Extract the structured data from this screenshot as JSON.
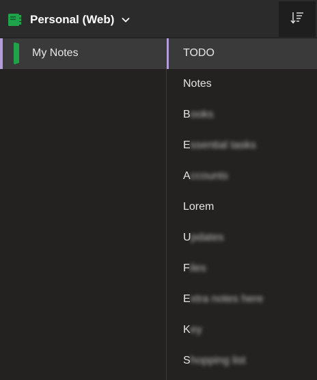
{
  "header": {
    "notebook_title": "Personal (Web)",
    "notebook_icon": "notebook-icon",
    "dropdown_icon": "chevron-down-icon",
    "sort_icon": "sort-icon",
    "accent_color": "#1fa34a"
  },
  "sections": {
    "items": [
      {
        "label": "My Notes",
        "selected": true,
        "color": "#1fa34a"
      }
    ],
    "selection_color": "#b39ddb"
  },
  "pages": {
    "items": [
      {
        "first": "TODO",
        "rest": "",
        "selected": true
      },
      {
        "first": "Notes",
        "rest": ""
      },
      {
        "first": "B",
        "rest": "ooks"
      },
      {
        "first": "E",
        "rest": "ssential tasks"
      },
      {
        "first": "A",
        "rest": "ccounts"
      },
      {
        "first": "Lorem",
        "rest": ""
      },
      {
        "first": "U",
        "rest": "pdates"
      },
      {
        "first": "F",
        "rest": "iles"
      },
      {
        "first": "E",
        "rest": "xtra notes here"
      },
      {
        "first": "K",
        "rest": "ey"
      },
      {
        "first": "S",
        "rest": "hopping list"
      }
    ]
  }
}
